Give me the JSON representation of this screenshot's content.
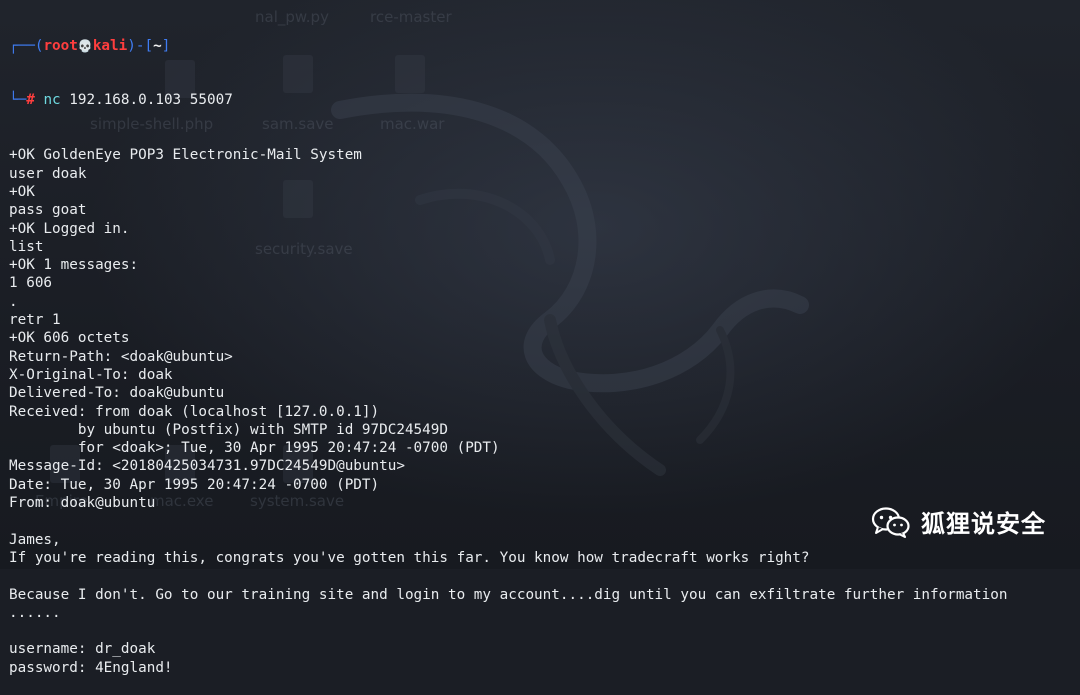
{
  "prompt": {
    "top_prefix": "┌──(",
    "user": "root",
    "skull": "💀",
    "host": "kali",
    "sep": ")-[",
    "dir": "~",
    "close": "]",
    "bottom_prefix": "└─",
    "hash": "#",
    "command_name": "nc",
    "command_args": " 192.168.0.103 55007"
  },
  "output_lines": [
    "+OK GoldenEye POP3 Electronic-Mail System",
    "user doak",
    "+OK",
    "pass goat",
    "+OK Logged in.",
    "list",
    "+OK 1 messages:",
    "1 606",
    ".",
    "retr 1",
    "+OK 606 octets",
    "Return-Path: <doak@ubuntu>",
    "X-Original-To: doak",
    "Delivered-To: doak@ubuntu",
    "Received: from doak (localhost [127.0.0.1])",
    "        by ubuntu (Postfix) with SMTP id 97DC24549D",
    "        for <doak>; Tue, 30 Apr 1995 20:47:24 -0700 (PDT)",
    "Message-Id: <20180425034731.97DC24549D@ubuntu>",
    "Date: Tue, 30 Apr 1995 20:47:24 -0700 (PDT)",
    "From: doak@ubuntu",
    "",
    "James,",
    "If you're reading this, congrats you've gotten this far. You know how tradecraft works right?",
    "",
    "Because I don't. Go to our training site and login to my account....dig until you can exfiltrate further information",
    "......",
    "",
    "username: dr_doak",
    "password: 4England!"
  ],
  "background_desktop": {
    "items": [
      "nal_pw.py",
      "rce-master",
      "simple-shell.php",
      "sam.save",
      "mac.war",
      "security.save",
      "Empire",
      "mac.exe",
      "system.save"
    ]
  },
  "watermark": {
    "icon": "wechat-icon",
    "text": "狐狸说安全"
  },
  "colors": {
    "background": "#1b1e25",
    "text": "#e9ecef",
    "prompt_blue": "#3f7cf2",
    "prompt_red": "#ff3e3e",
    "command_cyan": "#6ed9e0"
  }
}
